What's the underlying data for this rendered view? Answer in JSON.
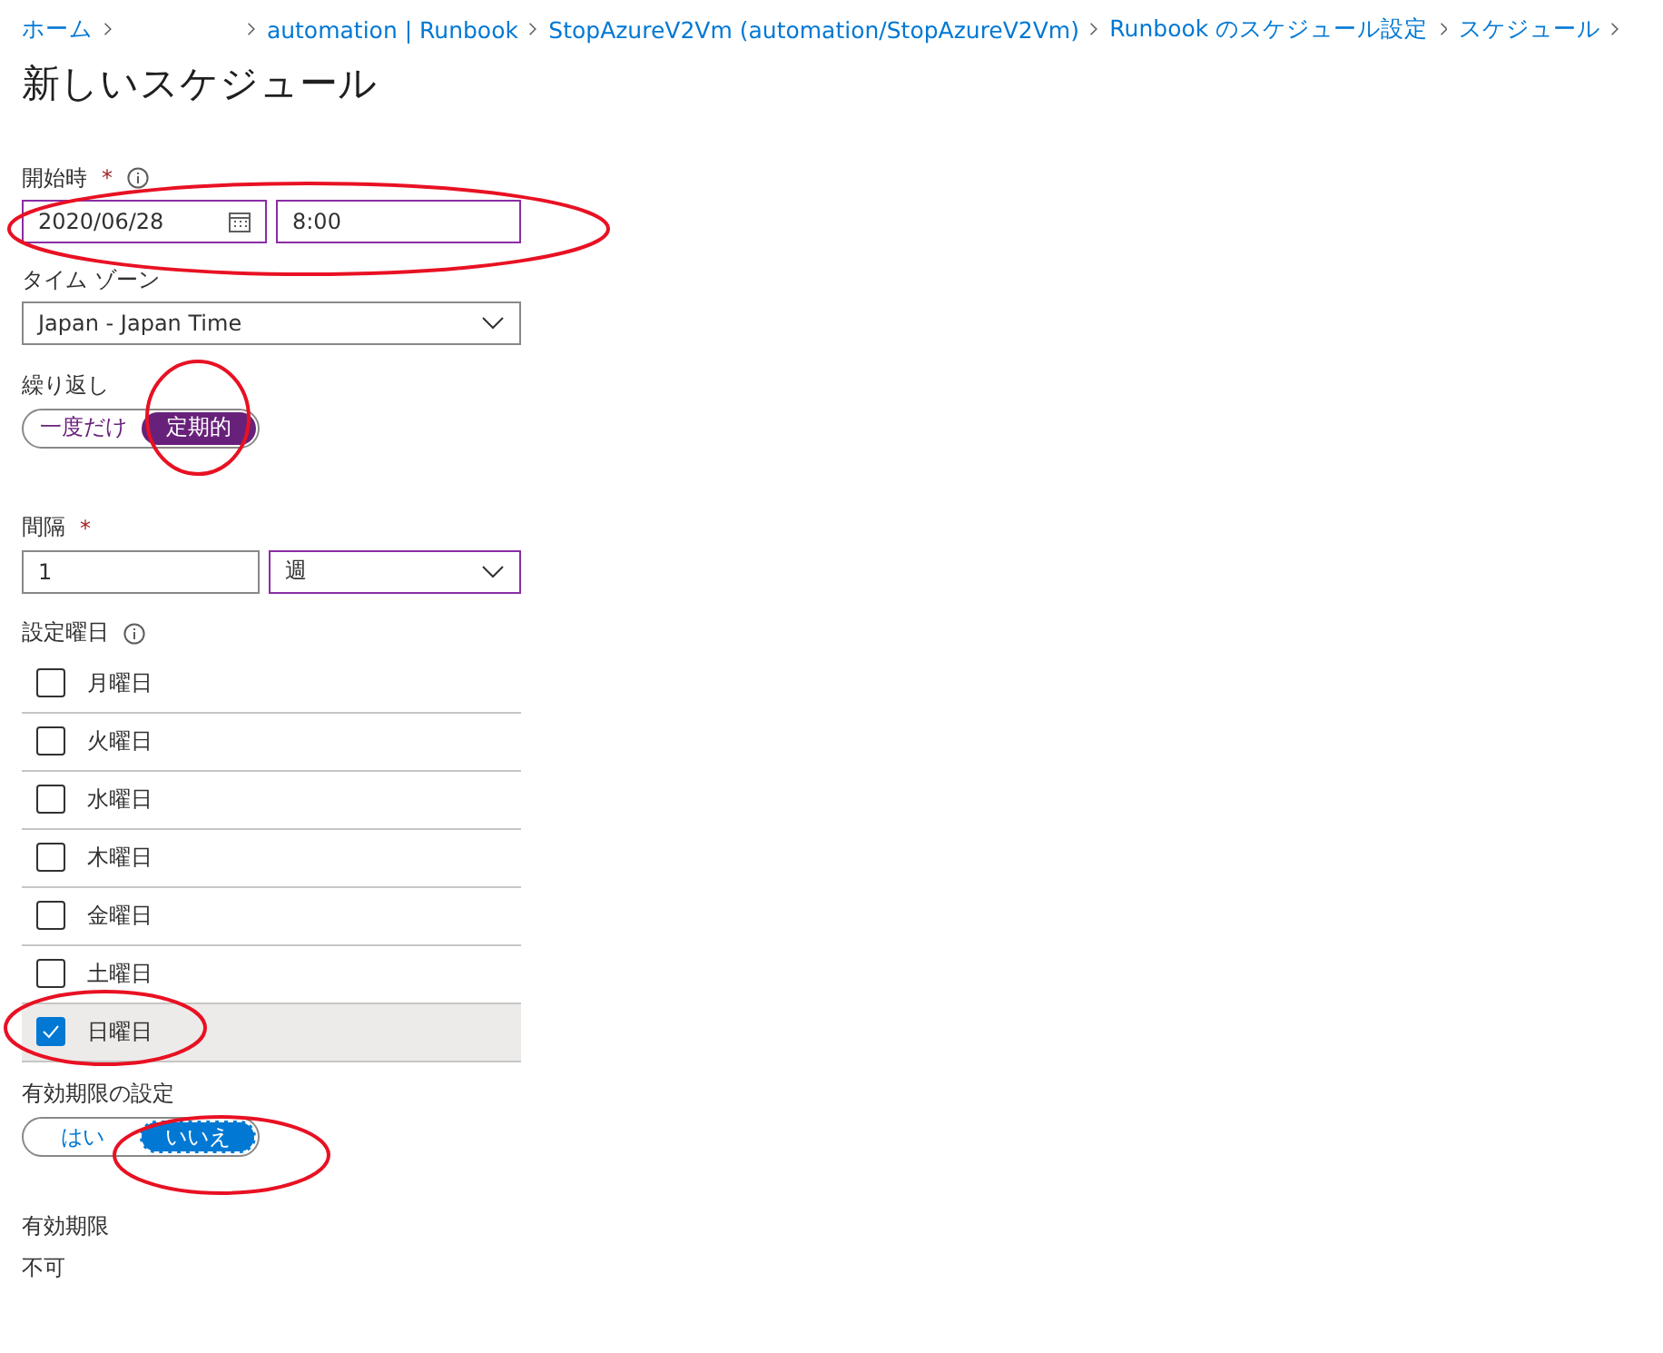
{
  "breadcrumb": [
    {
      "label": "ホーム"
    },
    {
      "label": "automation | Runbook"
    },
    {
      "label": "StopAzureV2Vm (automation/StopAzureV2Vm)"
    },
    {
      "label": "Runbook のスケジュール設定"
    },
    {
      "label": "スケジュール"
    }
  ],
  "title": "新しいスケジュール",
  "start": {
    "label": "開始時",
    "required_mark": "*",
    "date": "2020/06/28",
    "time": "8:00"
  },
  "timezone": {
    "label": "タイム ゾーン",
    "value": "Japan - Japan Time"
  },
  "recurrence": {
    "label": "繰り返し",
    "focused": false,
    "options": [
      {
        "label": "一度だけ",
        "selected": false
      },
      {
        "label": "定期的",
        "selected": true
      }
    ]
  },
  "interval": {
    "label": "間隔",
    "required_mark": "*",
    "value": "1",
    "unit": "週"
  },
  "weekdays": {
    "label": "設定曜日",
    "days": [
      {
        "label": "月曜日",
        "checked": false,
        "selected": false
      },
      {
        "label": "火曜日",
        "checked": false,
        "selected": false
      },
      {
        "label": "水曜日",
        "checked": false,
        "selected": false
      },
      {
        "label": "木曜日",
        "checked": false,
        "selected": false
      },
      {
        "label": "金曜日",
        "checked": false,
        "selected": false
      },
      {
        "label": "土曜日",
        "checked": false,
        "selected": false
      },
      {
        "label": "日曜日",
        "checked": true,
        "selected": true
      }
    ]
  },
  "expiration": {
    "label": "有効期限の設定",
    "focused": true,
    "options": [
      {
        "label": "はい",
        "selected": false
      },
      {
        "label": "いいえ",
        "selected": true
      }
    ]
  },
  "expires": {
    "label": "有効期限",
    "value": "不可"
  }
}
